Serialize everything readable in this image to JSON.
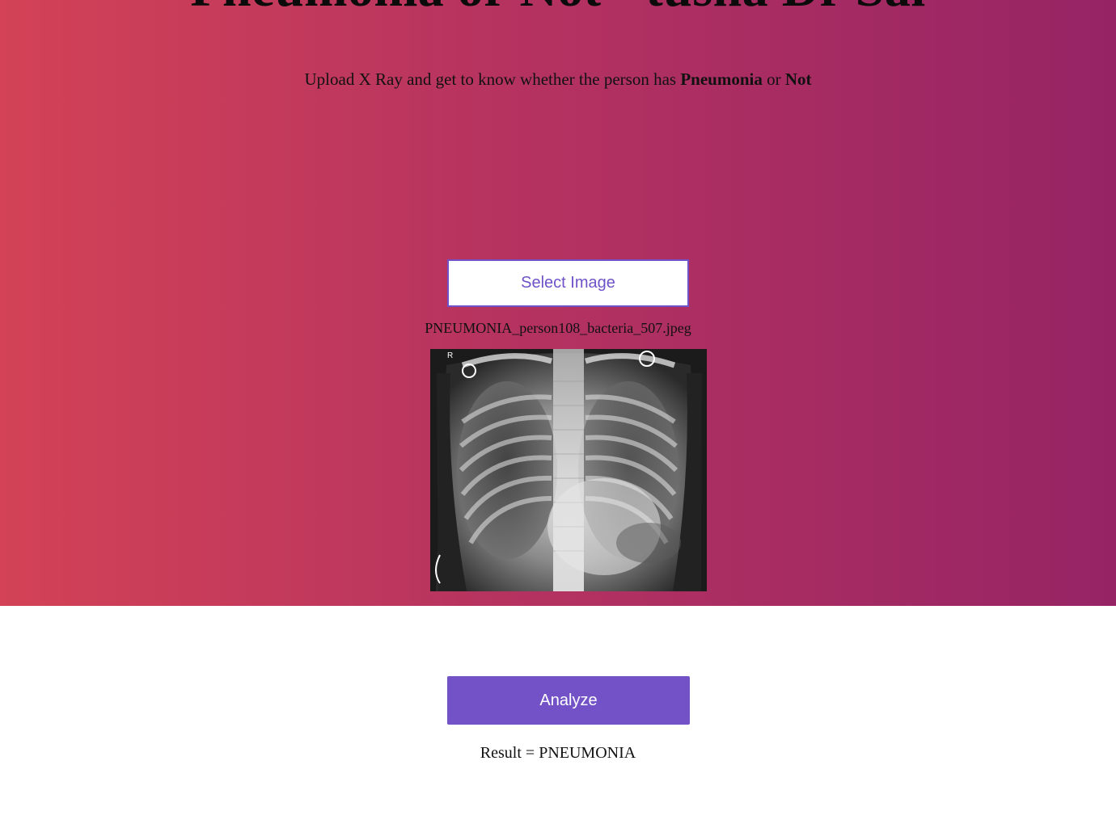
{
  "header": {
    "title": "Pneumonia or Not - tusha Dr Sai",
    "subtitle_prefix": "Upload X Ray and get to know whether the person has ",
    "subtitle_bold_1": "Pneumonia",
    "subtitle_middle": " or ",
    "subtitle_bold_2": "Not"
  },
  "upload": {
    "select_label": "Select Image",
    "file_name": "PNEUMONIA_person108_bacteria_507.jpeg",
    "image_marker": "R"
  },
  "analysis": {
    "analyze_label": "Analyze",
    "result_text": "Result = PNEUMONIA"
  },
  "colors": {
    "gradient_start": "#d34256",
    "gradient_end": "#962465",
    "accent": "#7352c7"
  }
}
